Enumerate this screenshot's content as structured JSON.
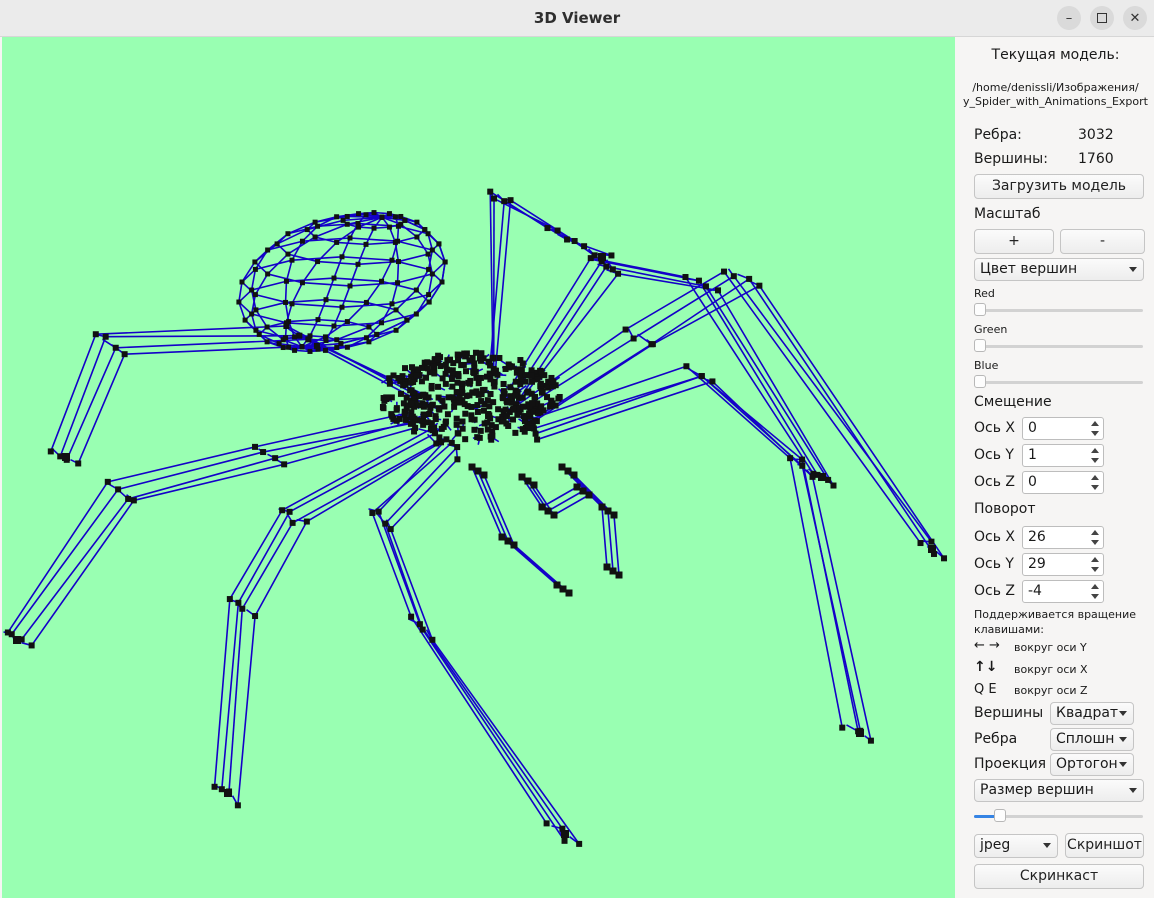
{
  "window": {
    "title": "3D Viewer"
  },
  "colors": {
    "viewport_bg": "#99ffb2",
    "edge": "#1400c8",
    "vertex": "#111111",
    "accent": "#3584e4"
  },
  "panel": {
    "current_model_label": "Текущая модель:",
    "model_path_line1": "/home/denissli/Изображения/",
    "model_path_line2": "y_Spider_with_Animations_Export",
    "edges_label": "Ребра:",
    "edges_value": "3032",
    "vertices_label": "Вершины:",
    "vertices_value": "1760",
    "load_button": "Загрузить модель",
    "scale_label": "Масштаб",
    "scale_plus": "+",
    "scale_minus": "-",
    "color_target": "Цвет вершин",
    "red_label": "Red",
    "green_label": "Green",
    "blue_label": "Blue",
    "red_value": 0,
    "green_value": 0,
    "blue_value": 0,
    "offset_label": "Смещение",
    "offset_x_label": "Ось X",
    "offset_y_label": "Ось Y",
    "offset_z_label": "Ось Z",
    "offset_x": "0",
    "offset_y": "1",
    "offset_z": "0",
    "rotation_label": "Поворот",
    "rot_x_label": "Ось X",
    "rot_y_label": "Ось Y",
    "rot_z_label": "Ось Z",
    "rot_x": "26",
    "rot_y": "29",
    "rot_z": "-4",
    "hint_line1": "Поддерживается вращение",
    "hint_line2": "клавишами:",
    "keys_lr": "← →",
    "keys_lr_desc": "вокруг оси Y",
    "keys_ud": "↑↓",
    "keys_ud_desc": "вокруг оси X",
    "keys_qe": "Q E",
    "keys_qe_desc": "вокруг оси Z",
    "vertices_type_label": "Вершины",
    "vertices_type_value": "Квадрат",
    "edges_type_label": "Ребра",
    "edges_type_value": "Сплошн",
    "projection_label": "Проекция",
    "projection_value": "Ортогон",
    "size_target": "Размер вершин",
    "size_value": 0.13,
    "format_value": "jpeg",
    "screenshot_button": "Скриншот",
    "screencast_button": "Скринкаст"
  }
}
